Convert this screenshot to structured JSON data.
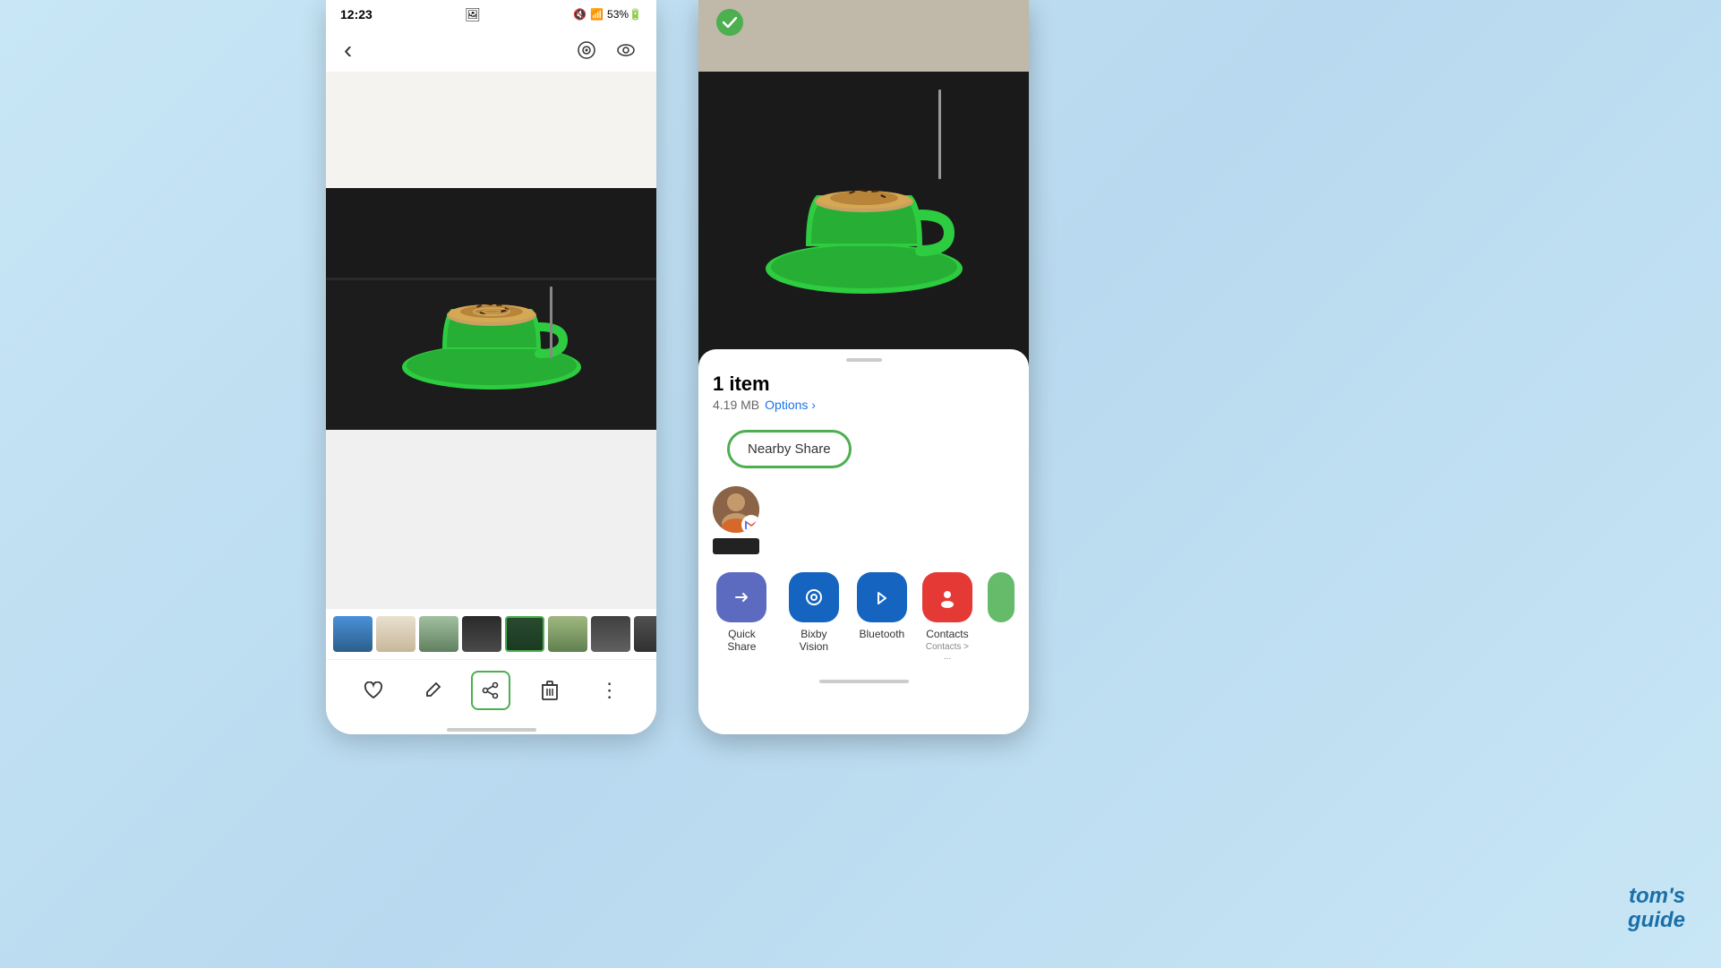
{
  "background": {
    "color": "#c8e6f5"
  },
  "phone_left": {
    "status_bar": {
      "time": "12:23",
      "icons": "🔇 📶 53%🔋"
    },
    "nav": {
      "back_label": "‹",
      "icon1": "⊙",
      "icon2": "👁"
    },
    "bottom_toolbar": {
      "heart_label": "♡",
      "edit_label": "✏",
      "share_label": "⎙",
      "delete_label": "🗑",
      "more_label": "⋮"
    },
    "home_bar": ""
  },
  "phone_right": {
    "share_sheet": {
      "item_count": "1 item",
      "file_size": "4.19 MB",
      "options_label": "Options",
      "nearby_share_label": "Nearby Share",
      "apps": [
        {
          "id": "quick-share",
          "label": "Quick Share",
          "icon": "↗",
          "color": "#5C6BC0"
        },
        {
          "id": "bixby-vision",
          "label": "Bixby Vision",
          "icon": "👁",
          "color": "#1565C0"
        },
        {
          "id": "bluetooth",
          "label": "Bluetooth",
          "icon": "ᛒ",
          "color": "#1565C0"
        },
        {
          "id": "contacts",
          "label": "Contacts",
          "sublabel": "Contacts > ...",
          "icon": "👤",
          "color": "#E53935"
        }
      ]
    }
  },
  "watermark": {
    "line1": "tom's",
    "line2": "guide"
  }
}
